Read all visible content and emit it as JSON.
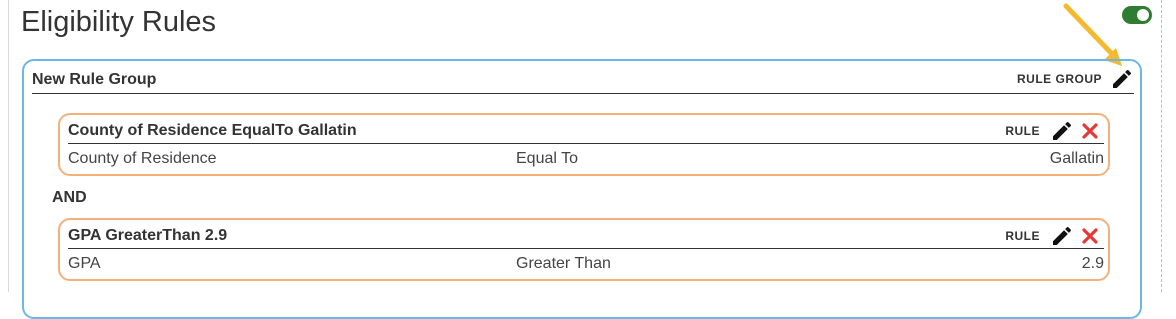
{
  "page": {
    "title": "Eligibility Rules",
    "toggle_on": true
  },
  "colors": {
    "group_border": "#6ab8e8",
    "rule_border": "#f4b07a",
    "toggle": "#2e7d32",
    "delete": "#e53935",
    "arrow": "#f5b82e"
  },
  "rule_group": {
    "title": "New Rule Group",
    "type_label": "RULE GROUP",
    "edit_icon": "pencil-icon",
    "connector": "AND",
    "rules": [
      {
        "title": "County of Residence EqualTo Gallatin",
        "type_label": "RULE",
        "field": "County of Residence",
        "operator": "Equal To",
        "value": "Gallatin",
        "edit_icon": "pencil-icon",
        "delete_icon": "close-icon"
      },
      {
        "title": "GPA GreaterThan 2.9",
        "type_label": "RULE",
        "field": "GPA",
        "operator": "Greater Than",
        "value": "2.9",
        "edit_icon": "pencil-icon",
        "delete_icon": "close-icon"
      }
    ]
  }
}
